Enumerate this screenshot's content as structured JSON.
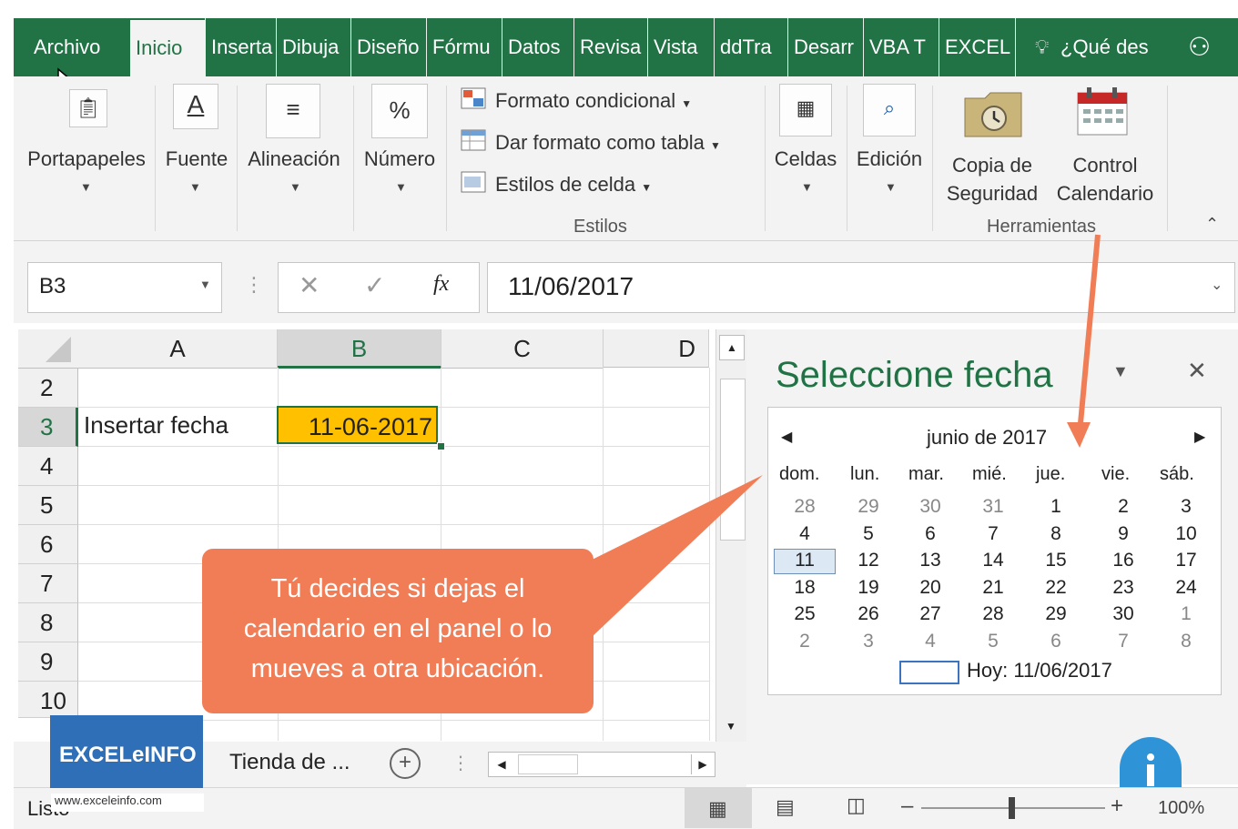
{
  "tabs": [
    "Archivo",
    "Inicio",
    "Inserta",
    "Dibuja",
    "Diseño",
    "Fórmu",
    "Datos",
    "Revisa",
    "Vista",
    "ddTra",
    "Desarr",
    "VBA T",
    "EXCEL"
  ],
  "tell_me": "¿Qué des",
  "ribbon": {
    "portapapeles": "Portapapeles",
    "fuente": "Fuente",
    "alineacion": "Alineación",
    "numero": "Número",
    "numero_icon": "%",
    "fuente_icon": "A",
    "formato_condicional": "Formato condicional",
    "dar_formato_tabla": "Dar formato como tabla",
    "estilos_celda": "Estilos de celda",
    "estilos_group": "Estilos",
    "celdas": "Celdas",
    "edicion": "Edición",
    "copia_1": "Copia de",
    "copia_2": "Seguridad",
    "control_1": "Control",
    "control_2": "Calendario",
    "herramientas_group": "Herramientas"
  },
  "formula_bar": {
    "name_box": "B3",
    "formula": "11/06/2017",
    "fx": "fx"
  },
  "grid": {
    "columns": [
      "A",
      "B",
      "C",
      "D"
    ],
    "rows": [
      "2",
      "3",
      "4",
      "5",
      "6",
      "7",
      "8",
      "9",
      "10"
    ],
    "a3": "Insertar fecha",
    "b3": "11-06-2017"
  },
  "pane": {
    "title": "Seleccione fecha",
    "month": "junio de 2017",
    "weekdays": [
      "dom.",
      "lun.",
      "mar.",
      "mié.",
      "jue.",
      "vie.",
      "sáb."
    ],
    "weeks": [
      [
        "28",
        "29",
        "30",
        "31",
        "1",
        "2",
        "3"
      ],
      [
        "4",
        "5",
        "6",
        "7",
        "8",
        "9",
        "10"
      ],
      [
        "11",
        "12",
        "13",
        "14",
        "15",
        "16",
        "17"
      ],
      [
        "18",
        "19",
        "20",
        "21",
        "22",
        "23",
        "24"
      ],
      [
        "25",
        "26",
        "27",
        "28",
        "29",
        "30",
        "1"
      ],
      [
        "2",
        "3",
        "4",
        "5",
        "6",
        "7",
        "8"
      ]
    ],
    "today": "Hoy: 11/06/2017"
  },
  "callout": {
    "line1": "Tú decides si dejas el",
    "line2": "calendario en el panel o lo",
    "line3": "mueves a otra ubicación."
  },
  "sheet_tab": "Tienda de ...",
  "logo": {
    "name": "EXCELeINFO",
    "url": "www.exceleinfo.com"
  },
  "status": {
    "ready": "Listo",
    "zoom": "100%"
  },
  "colors": {
    "excel_green": "#217346",
    "highlight": "#ffc000",
    "callout": "#f17d57",
    "selected_day": "#dde8f5"
  }
}
